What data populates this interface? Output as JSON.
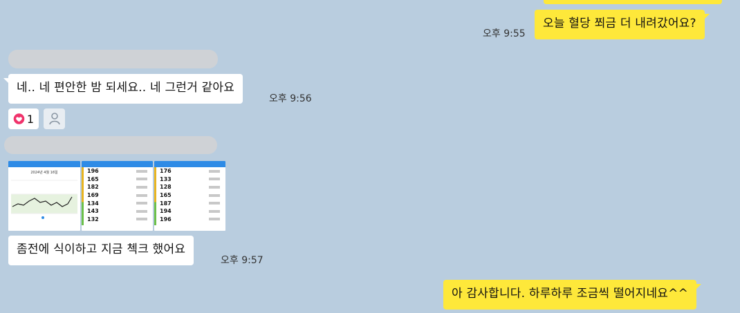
{
  "messages": [
    {
      "id": "m1",
      "side": "me",
      "text": "오늘 혈당 쬐금 더 내려갔어요?",
      "time": "오후 9:55"
    },
    {
      "id": "m2",
      "side": "other",
      "text": "네.. 네 편안한 밤 되세요.. 네 그런거 같아요",
      "time": "오후 9:56"
    },
    {
      "id": "m3",
      "side": "other",
      "text": "좀전에 식이하고 지금 첵크 했어요",
      "time": "오후 9:57"
    },
    {
      "id": "m4",
      "side": "me",
      "text": "아 감사합니다. 하루하루 조금씩 떨어지네요^^",
      "time": ""
    }
  ],
  "reaction": {
    "icon": "heart-icon",
    "count": "1",
    "color": "#f0336b"
  },
  "profile_icon": "person-icon",
  "screenshot_values": {
    "left_chart_header": "2024년 4월 16일",
    "middle": [
      "196",
      "165",
      "182",
      "169",
      "134",
      "143",
      "132"
    ],
    "right": [
      "176",
      "133",
      "128",
      "165",
      "187",
      "194",
      "196"
    ]
  }
}
